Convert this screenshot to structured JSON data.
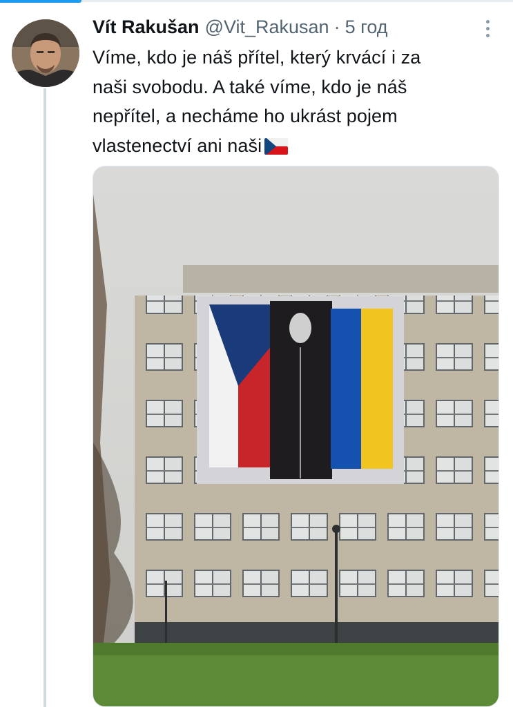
{
  "tweet": {
    "author_name": "Vít Rakušan",
    "handle": "@Vit_Rakusan",
    "separator": "·",
    "time": "5 год",
    "text_lines": [
      "Víme, kdo je náš přítel, který krvácí i za",
      "naši svobodu. A také víme, kdo je náš",
      "nepřítel, a necháme ho ukrást pojem",
      "vlastenectví ani naši"
    ],
    "emoji": "flag-czech-republic",
    "media": {
      "type": "photo",
      "content": "office-building-with-czech-and-ukrainian-flag-banner"
    }
  },
  "colors": {
    "text": "#0f1419",
    "secondary": "#536471",
    "accent": "#1d9bf0",
    "thread_line": "#cfd9de"
  }
}
